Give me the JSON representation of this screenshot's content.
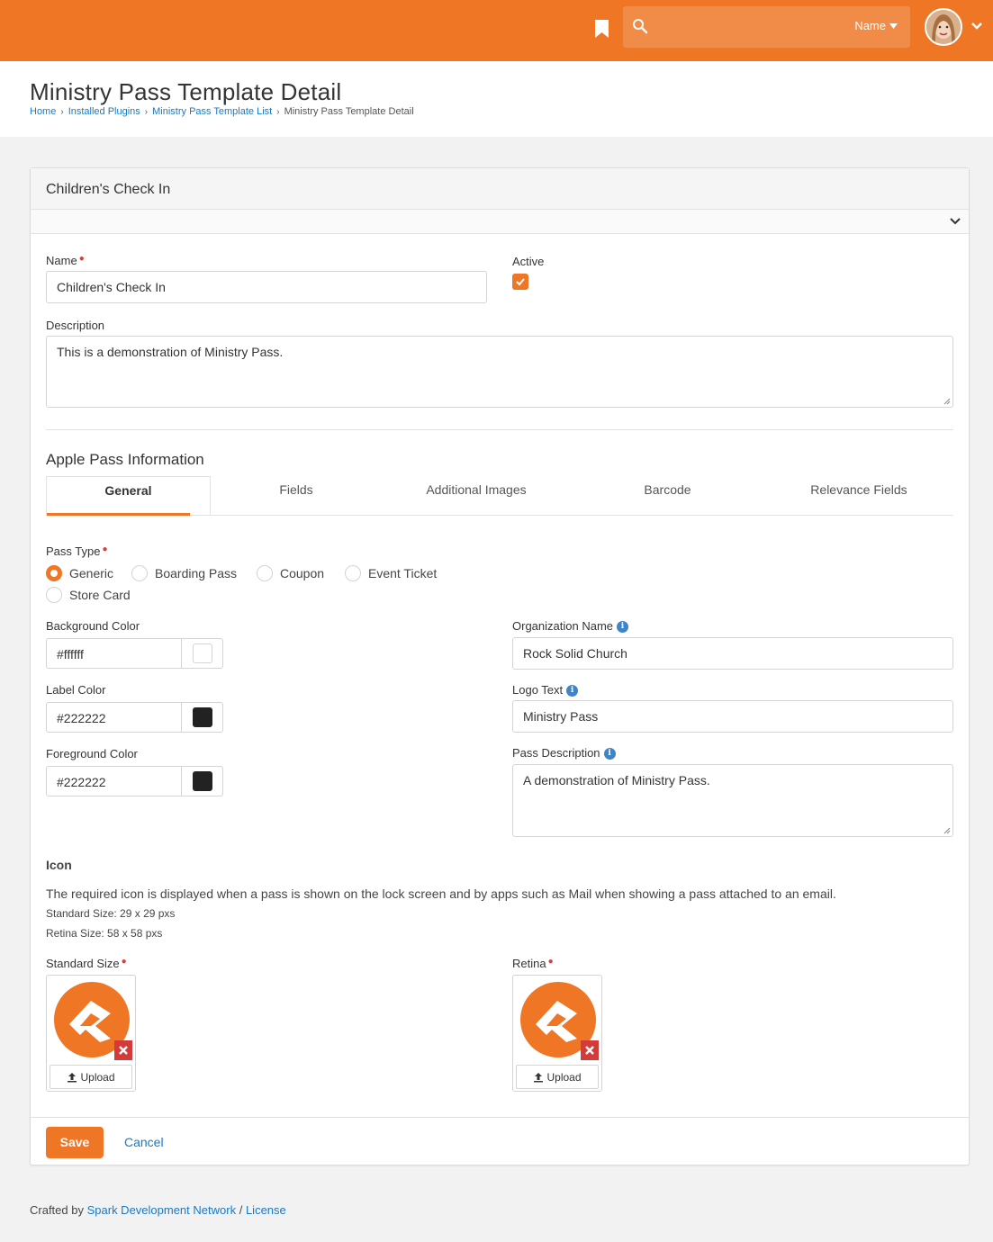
{
  "header": {
    "search_filter_label": "Name",
    "brand_color": "#ee7625"
  },
  "page": {
    "title": "Ministry Pass Template Detail",
    "breadcrumb": [
      "Home",
      "Installed Plugins",
      "Ministry Pass Template List",
      "Ministry Pass Template Detail"
    ]
  },
  "panel": {
    "title": "Children's Check In"
  },
  "form": {
    "name_label": "Name",
    "name_value": "Children's Check In",
    "active_label": "Active",
    "active_checked": true,
    "description_label": "Description",
    "description_value": "This is a demonstration of Ministry Pass.",
    "apple_section_title": "Apple Pass Information",
    "tabs": [
      "General",
      "Fields",
      "Additional Images",
      "Barcode",
      "Relevance Fields"
    ],
    "active_tab": "General",
    "pass_type_label": "Pass Type",
    "pass_types": [
      "Generic",
      "Boarding Pass",
      "Coupon",
      "Event Ticket",
      "Store Card"
    ],
    "pass_type_selected": "Generic",
    "background_color_label": "Background Color",
    "background_color_value": "#ffffff",
    "label_color_label": "Label Color",
    "label_color_value": "#222222",
    "foreground_color_label": "Foreground Color",
    "foreground_color_value": "#222222",
    "organization_name_label": "Organization Name",
    "organization_name_value": "Rock Solid Church",
    "logo_text_label": "Logo Text",
    "logo_text_value": "Ministry Pass",
    "pass_description_label": "Pass Description",
    "pass_description_value": "A demonstration of Ministry Pass.",
    "icon_title": "Icon",
    "icon_help": "The required icon is displayed when a pass is shown on the lock screen and by apps such as Mail when showing a pass attached to an email.",
    "icon_standard_size_note": "Standard Size: 29 x 29 pxs",
    "icon_retina_size_note": "Retina Size: 58 x 58 pxs",
    "standard_size_label": "Standard Size",
    "retina_label": "Retina",
    "upload_label": "Upload"
  },
  "actions": {
    "save_label": "Save",
    "cancel_label": "Cancel"
  },
  "footer": {
    "prefix": "Crafted by",
    "link1": "Spark Development Network",
    "sep": "/",
    "link2": "License"
  }
}
